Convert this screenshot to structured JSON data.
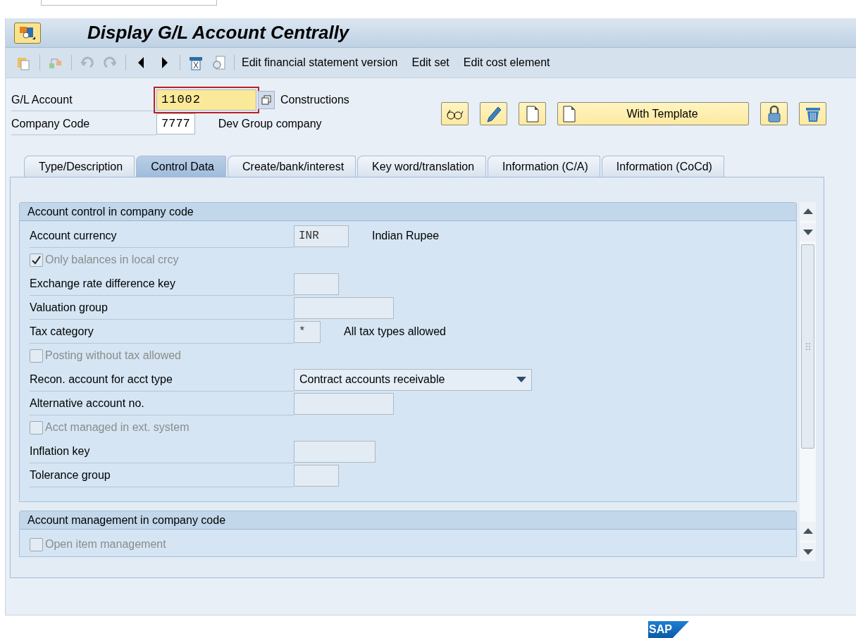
{
  "title": "Display G/L Account Centrally",
  "toolbar": {
    "links": [
      "Edit financial statement version",
      "Edit set",
      "Edit cost element"
    ]
  },
  "header_fields": [
    {
      "label": "G/L Account",
      "value": "11002",
      "description": "Constructions",
      "focused": true
    },
    {
      "label": "Company Code",
      "value": "7777",
      "description": "Dev Group company",
      "focused": false
    }
  ],
  "action_buttons": [
    {
      "kind": "display"
    },
    {
      "kind": "change"
    },
    {
      "kind": "create"
    },
    {
      "kind": "template",
      "label": "With Template"
    },
    {
      "kind": "lock"
    },
    {
      "kind": "delete"
    }
  ],
  "tabs": [
    {
      "label": "Type/Description",
      "selected": false
    },
    {
      "label": "Control Data",
      "selected": true
    },
    {
      "label": "Create/bank/interest",
      "selected": false
    },
    {
      "label": "Key word/translation",
      "selected": false
    },
    {
      "label": "Information (C/A)",
      "selected": false
    },
    {
      "label": "Information (CoCd)",
      "selected": false
    }
  ],
  "sections": [
    {
      "title": "Account control in company code",
      "rows": [
        {
          "kind": "field",
          "label": "Account currency",
          "value": "INR",
          "description": "Indian Rupee"
        },
        {
          "kind": "checkbox",
          "label": "Only balances in local crcy",
          "checked": true,
          "disabled": true
        },
        {
          "kind": "field",
          "label": "Exchange rate difference key"
        },
        {
          "kind": "field",
          "label": "Valuation group"
        },
        {
          "kind": "field",
          "label": "Tax category",
          "value": "*",
          "description": "All tax types allowed"
        },
        {
          "kind": "checkbox",
          "label": "Posting without tax allowed",
          "checked": false,
          "disabled": true
        },
        {
          "kind": "dropdown",
          "label": "Recon. account for acct type",
          "value": "Contract accounts receivable"
        },
        {
          "kind": "field",
          "label": "Alternative account no."
        },
        {
          "kind": "checkbox",
          "label": "Acct managed in ext. system",
          "checked": false,
          "disabled": true
        },
        {
          "kind": "field",
          "label": "Inflation key"
        },
        {
          "kind": "field",
          "label": "Tolerance group"
        }
      ]
    },
    {
      "title": "Account management in company code",
      "rows": [
        {
          "kind": "checkbox",
          "label": "Open item management",
          "checked": false,
          "disabled": true
        }
      ]
    }
  ],
  "logo": "SAP"
}
